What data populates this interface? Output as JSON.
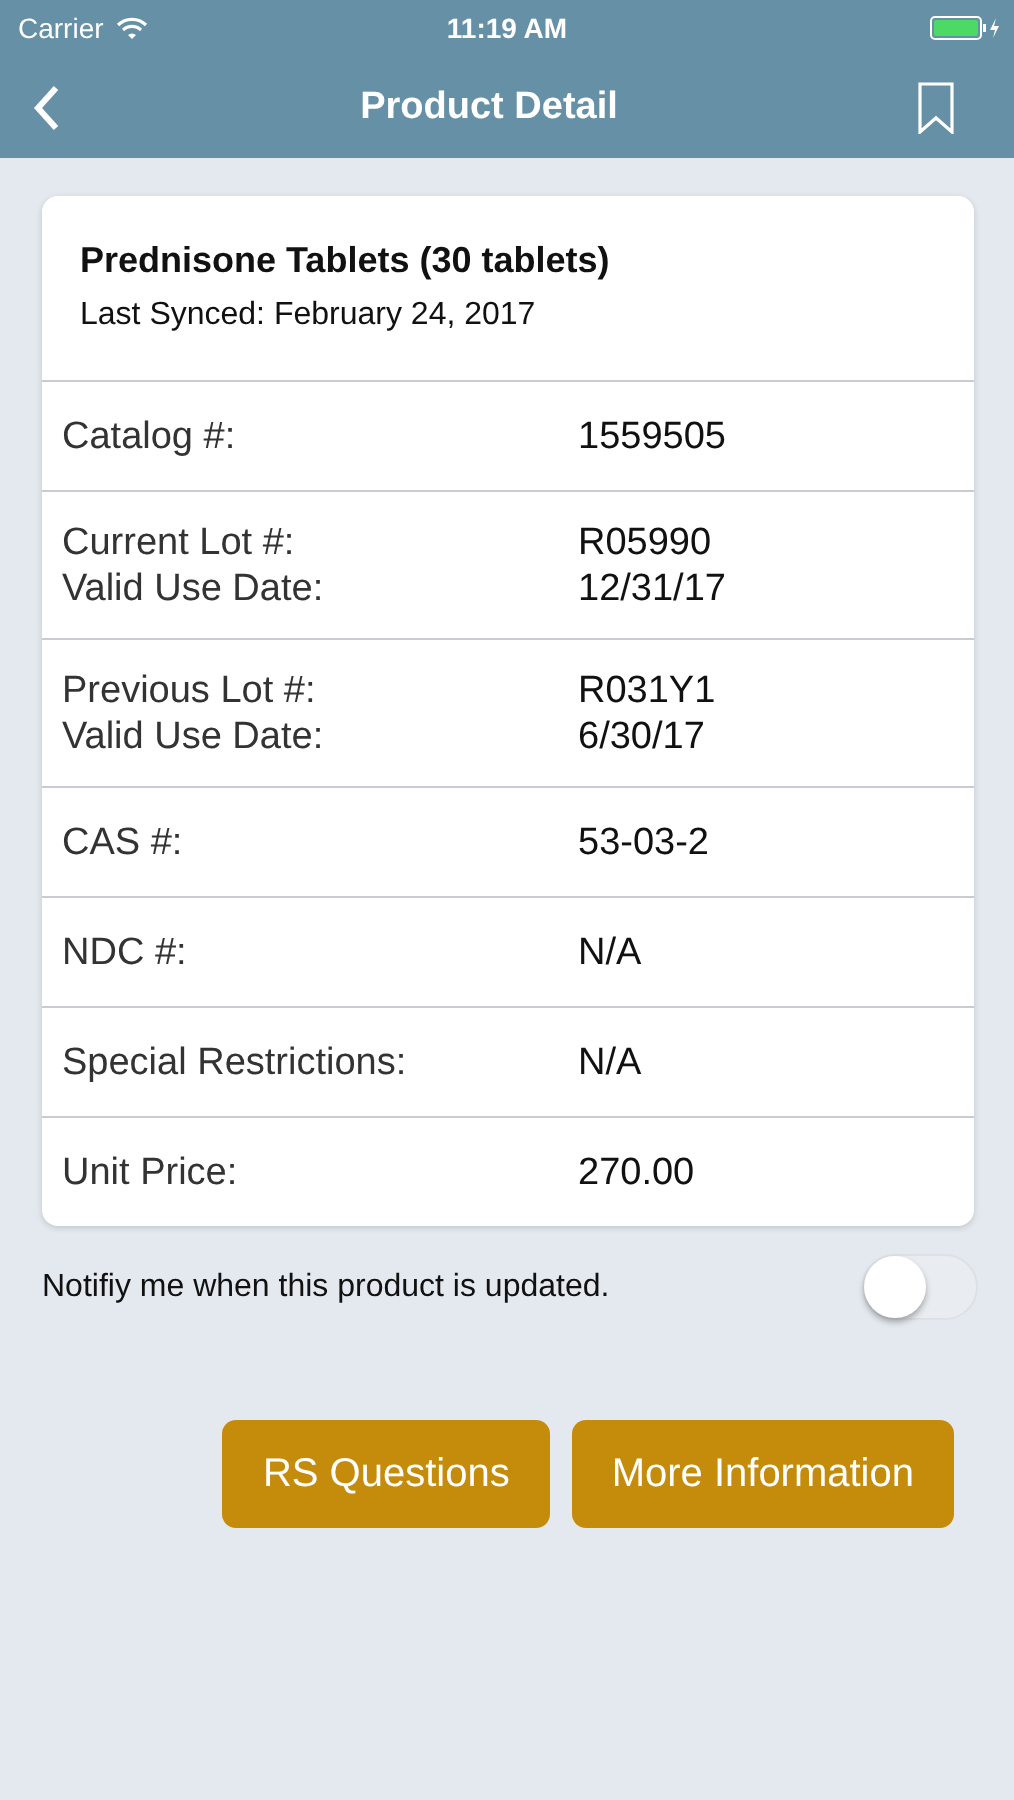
{
  "status_bar": {
    "carrier": "Carrier",
    "time": "11:19 AM",
    "charging": true
  },
  "nav": {
    "title": "Product Detail"
  },
  "product": {
    "name": "Prednisone Tablets (30 tablets)",
    "synced": "Last Synced: February 24, 2017"
  },
  "rows": [
    {
      "labels": [
        "Catalog #:"
      ],
      "values": [
        "1559505"
      ]
    },
    {
      "labels": [
        "Current Lot #:",
        "Valid Use Date:"
      ],
      "values": [
        "R05990",
        "12/31/17"
      ]
    },
    {
      "labels": [
        "Previous Lot #:",
        "Valid Use Date:"
      ],
      "values": [
        "R031Y1",
        "6/30/17"
      ]
    },
    {
      "labels": [
        "CAS #:"
      ],
      "values": [
        "53-03-2"
      ]
    },
    {
      "labels": [
        "NDC #:"
      ],
      "values": [
        "N/A"
      ]
    },
    {
      "labels": [
        "Special Restrictions:"
      ],
      "values": [
        "N/A"
      ]
    },
    {
      "labels": [
        "Unit Price:"
      ],
      "values": [
        "270.00"
      ]
    }
  ],
  "notify": {
    "label": "Notifiy me when this product is updated.",
    "on": false
  },
  "buttons": [
    "RS Questions",
    "More Information"
  ]
}
